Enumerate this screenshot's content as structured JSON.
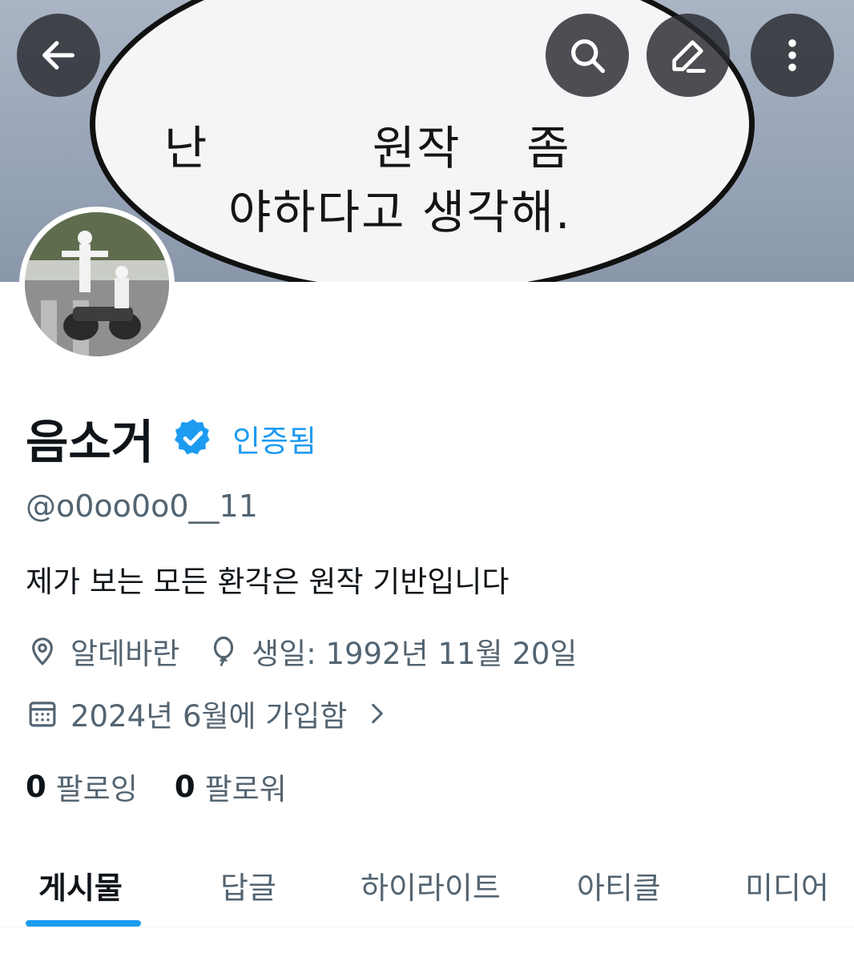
{
  "banner": {
    "line1": "난          원작    좀",
    "line2": "야하다고 생각해."
  },
  "profile": {
    "name": "음소거",
    "verified_label": "인증됨",
    "handle": "@o0oo0o0__11",
    "bio": "제가 보는 모든 환각은 원작 기반입니다",
    "location": "알데바란",
    "birthday": "생일: 1992년 11월 20일",
    "joined": "2024년 6월에 가입함",
    "following_count": "0",
    "following_label": "팔로잉",
    "followers_count": "0",
    "followers_label": "팔로워"
  },
  "tabs": [
    {
      "label": "게시물",
      "active": true
    },
    {
      "label": "답글"
    },
    {
      "label": "하이라이트"
    },
    {
      "label": "아티클"
    },
    {
      "label": "미디어"
    }
  ],
  "colors": {
    "accent": "#1d9bf0",
    "secondary_text": "#536471",
    "primary_text": "#0f1419"
  },
  "icons": [
    "back-arrow-icon",
    "search-icon",
    "edit-icon",
    "more-vertical-icon",
    "verified-badge-icon",
    "location-pin-icon",
    "balloon-icon",
    "calendar-icon",
    "chevron-right-icon"
  ]
}
